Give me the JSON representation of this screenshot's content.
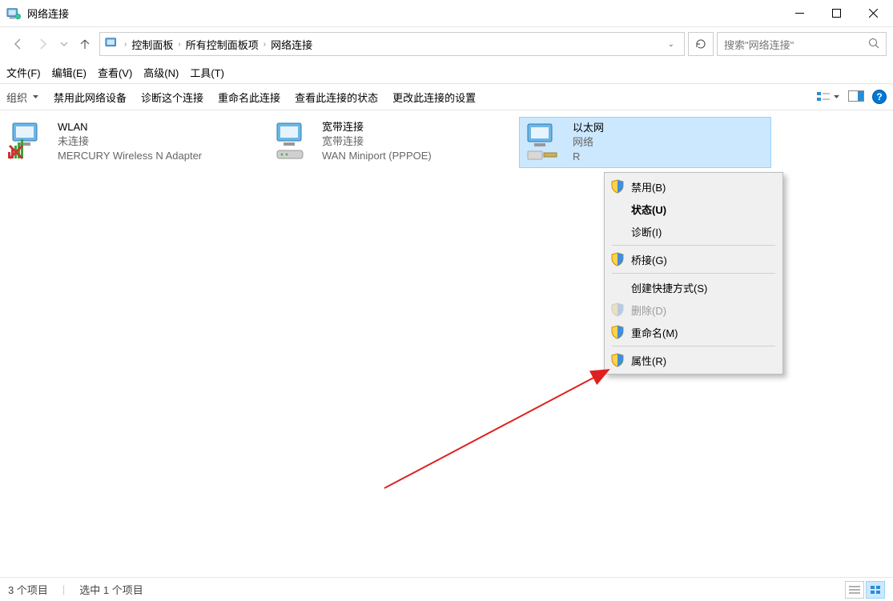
{
  "window": {
    "title": "网络连接"
  },
  "breadcrumb": {
    "root_icon": "control-panel",
    "seg1": "控制面板",
    "seg2": "所有控制面板项",
    "seg3": "网络连接"
  },
  "search": {
    "placeholder": "搜索\"网络连接\""
  },
  "menubar": {
    "file": "文件(F)",
    "edit": "编辑(E)",
    "view": "查看(V)",
    "advanced": "高级(N)",
    "tools": "工具(T)"
  },
  "cmdbar": {
    "organize": "组织",
    "disable": "禁用此网络设备",
    "diagnose": "诊断这个连接",
    "rename": "重命名此连接",
    "status": "查看此连接的状态",
    "change": "更改此连接的设置"
  },
  "connections": [
    {
      "name": "WLAN",
      "status": "未连接",
      "adapter": "MERCURY Wireless N Adapter",
      "kind": "wlan-disconnected"
    },
    {
      "name": "宽带连接",
      "status": "宽带连接",
      "adapter": "WAN Miniport (PPPOE)",
      "kind": "dialup"
    },
    {
      "name": "以太网",
      "status": "网络",
      "adapter": "R",
      "kind": "ethernet",
      "selected": true
    }
  ],
  "context_menu": [
    {
      "label": "禁用(B)",
      "shield": true
    },
    {
      "label": "状态(U)",
      "bold": true
    },
    {
      "label": "诊断(I)"
    },
    {
      "sep": true
    },
    {
      "label": "桥接(G)",
      "shield": true
    },
    {
      "sep": true
    },
    {
      "label": "创建快捷方式(S)"
    },
    {
      "label": "删除(D)",
      "shield": true,
      "disabled": true
    },
    {
      "label": "重命名(M)",
      "shield": true
    },
    {
      "sep": true
    },
    {
      "label": "属性(R)",
      "shield": true
    }
  ],
  "statusbar": {
    "count": "3 个项目",
    "selected": "选中 1 个项目"
  }
}
